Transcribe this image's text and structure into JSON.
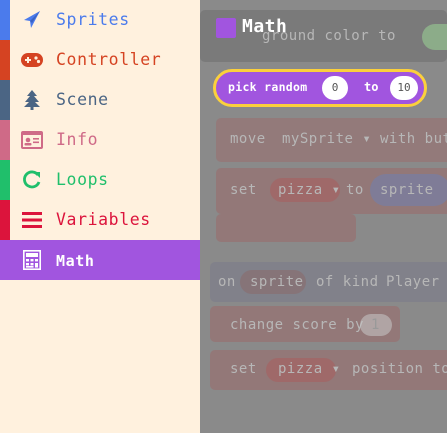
{
  "toolbox": {
    "categories": [
      {
        "label": "Sprites",
        "icon": "paper-plane-icon",
        "color": "#4b7bec"
      },
      {
        "label": "Controller",
        "icon": "gamepad-icon",
        "color": "#d54322"
      },
      {
        "label": "Scene",
        "icon": "tree-icon",
        "color": "#4b6584"
      },
      {
        "label": "Info",
        "icon": "id-card-icon",
        "color": "#cf6a87"
      },
      {
        "label": "Loops",
        "icon": "refresh-icon",
        "color": "#20bf6b"
      },
      {
        "label": "Variables",
        "icon": "list-icon",
        "color": "#dc143c"
      },
      {
        "label": "Math",
        "icon": "calculator-icon",
        "color": "#a155df"
      }
    ],
    "selected": "Math"
  },
  "flyout": {
    "title": "Math",
    "blocks": [
      {
        "label": "pick random",
        "from": "0",
        "to_label": "to",
        "to": "10"
      }
    ]
  },
  "workspace_ghost": {
    "line1": "ground color to",
    "line2_a": "move",
    "line2_b": "mySprite ▾",
    "line2_c": "with but",
    "line3_a": "set",
    "line3_b": "pizza ▾",
    "line3_c": "to",
    "line3_d": "sprite",
    "line4_a": "on",
    "line4_b": "sprite",
    "line4_c": "of kind",
    "line4_d": "Player ▾",
    "line5_a": "change score by",
    "line5_b": "1",
    "line6_a": "set",
    "line6_b": "pizza ▾",
    "line6_c": "position to"
  }
}
